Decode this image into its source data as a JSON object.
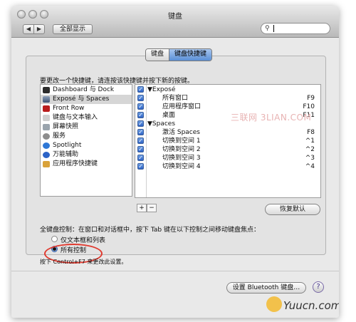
{
  "window": {
    "title": "键盘"
  },
  "toolbar": {
    "back": "◀",
    "forward": "▶",
    "show_all": "全部显示",
    "search_icon": "search-icon"
  },
  "tabs": [
    {
      "label": "键盘",
      "active": false
    },
    {
      "label": "键盘快捷键",
      "active": true
    }
  ],
  "instruction": "要更改一个快捷键，请连按该快捷键并按下新的按键。",
  "categories": [
    {
      "label": "Dashboard 与 Dock",
      "icon": "dashboard-icon",
      "selected": false
    },
    {
      "label": "Exposé 与 Spaces",
      "icon": "expose-icon",
      "selected": true
    },
    {
      "label": "Front Row",
      "icon": "front-row-icon",
      "selected": false
    },
    {
      "label": "键盘与文本输入",
      "icon": "keyboard-icon",
      "selected": false
    },
    {
      "label": "屏幕快照",
      "icon": "screenshot-icon",
      "selected": false
    },
    {
      "label": "服务",
      "icon": "gear-icon",
      "selected": false
    },
    {
      "label": "Spotlight",
      "icon": "spotlight-icon",
      "selected": false
    },
    {
      "label": "万能辅助",
      "icon": "accessibility-icon",
      "selected": false
    },
    {
      "label": "应用程序快捷键",
      "icon": "app-shortcuts-icon",
      "selected": false
    }
  ],
  "shortcuts": [
    {
      "type": "group",
      "name": "Exposé",
      "key": ""
    },
    {
      "type": "item",
      "name": "所有窗口",
      "key": "F9"
    },
    {
      "type": "item",
      "name": "应用程序窗口",
      "key": "F10"
    },
    {
      "type": "item",
      "name": "桌面",
      "key": "F11"
    },
    {
      "type": "group",
      "name": "Spaces",
      "key": ""
    },
    {
      "type": "item",
      "name": "激活 Spaces",
      "key": "F8"
    },
    {
      "type": "item",
      "name": "切换到空间 1",
      "key": "^1"
    },
    {
      "type": "item",
      "name": "切换到空间 2",
      "key": "^2"
    },
    {
      "type": "item",
      "name": "切换到空间 3",
      "key": "^3"
    },
    {
      "type": "item",
      "name": "切换到空间 4",
      "key": "^4"
    }
  ],
  "table_buttons": {
    "add": "+",
    "remove": "−",
    "restore": "恢复默认"
  },
  "full_keyboard": {
    "label": "全键盘控制：在窗口和对话框中，按下 Tab 键在以下控制之间移动键盘焦点：",
    "options": [
      {
        "label": "仅文本框和列表",
        "selected": false
      },
      {
        "label": "所有控制",
        "selected": true
      }
    ],
    "hint": "按下 Control+F7 来更改此设置。"
  },
  "bottom": {
    "bluetooth": "设置 Bluetooth 键盘…",
    "help": "?"
  },
  "watermarks": {
    "center": "三联网 3LIAN.COM",
    "corner": "Yuucn.com"
  },
  "colors": {
    "accent": "#3f74cf",
    "highlight_circle": "#e03a2f"
  }
}
